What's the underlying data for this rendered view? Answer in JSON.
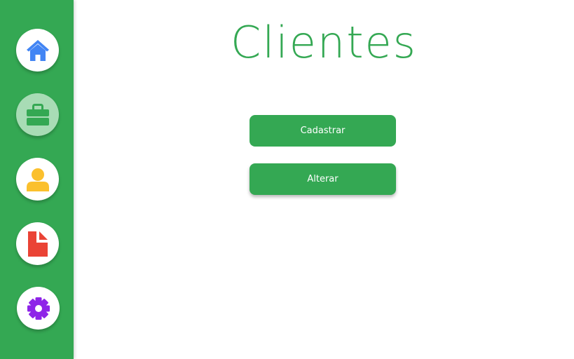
{
  "page": {
    "title": "Clientes"
  },
  "sidebar": {
    "items": [
      {
        "icon": "home-icon",
        "color": "#4285f4"
      },
      {
        "icon": "briefcase-icon",
        "color": "#34a853",
        "active": true
      },
      {
        "icon": "user-icon",
        "color": "#fbc02d"
      },
      {
        "icon": "document-icon",
        "color": "#ea4335"
      },
      {
        "icon": "gear-icon",
        "color": "#8e24e8"
      }
    ]
  },
  "actions": {
    "cadastrar_label": "Cadastrar",
    "alterar_label": "Alterar"
  },
  "colors": {
    "brand_green": "#34a853",
    "active_nav_bg": "#a8dcb5"
  }
}
